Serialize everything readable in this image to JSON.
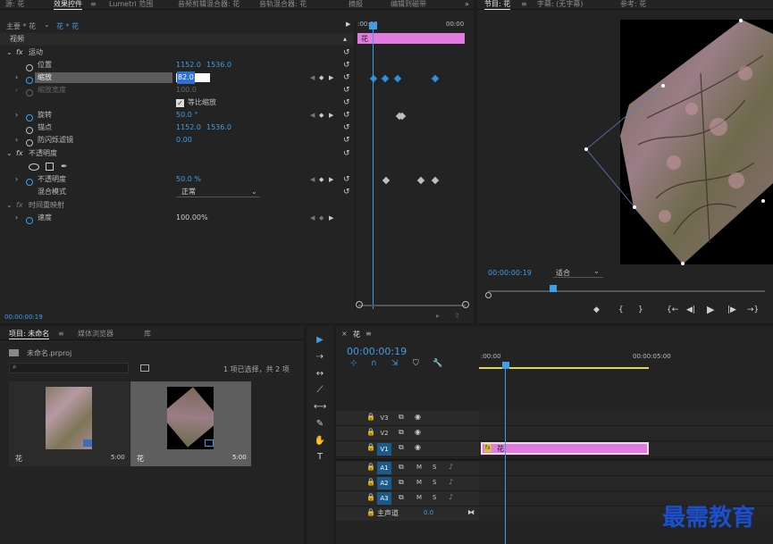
{
  "top_tabs": [
    {
      "label": "源: 花",
      "active": false
    },
    {
      "label": "效果控件",
      "active": true
    },
    {
      "label": "Lumetri 范围",
      "active": false
    },
    {
      "label": "音频剪辑混合器: 花",
      "active": false
    },
    {
      "label": "音轨混合器: 花",
      "active": false
    },
    {
      "label": "摘报",
      "active": false
    },
    {
      "label": "编辑到磁带",
      "active": false
    }
  ],
  "tab_menu_glyph": "≡",
  "overflow_glyph": "»",
  "effect_controls": {
    "master": "主要 * 花",
    "clip": "花 * 花",
    "ruler_start": ":00:00",
    "ruler_end": "00:00",
    "clip_bar_label": "花",
    "section_video": "视频",
    "motion": "运动",
    "position": {
      "label": "位置",
      "x": "1152.0",
      "y": "1536.0"
    },
    "scale": {
      "label": "缩放",
      "value": "82.0"
    },
    "scale_width": {
      "label": "缩放宽度",
      "value": "100.0"
    },
    "uniform_scale": {
      "label": "等比缩放",
      "checked": true
    },
    "rotation": {
      "label": "旋转",
      "value": "50.0 °"
    },
    "anchor": {
      "label": "锚点",
      "x": "1152.0",
      "y": "1536.0"
    },
    "antiflicker": {
      "label": "防闪烁滤镜",
      "value": "0.00"
    },
    "opacity_section": "不透明度",
    "opacity": {
      "label": "不透明度",
      "value": "50.0 %"
    },
    "blend": {
      "label": "混合模式",
      "value": "正常"
    },
    "time_remap": "时间重映射",
    "speed": {
      "label": "速度",
      "value": "100.00%"
    },
    "timecode": "00:00:00:19"
  },
  "program": {
    "tabs": [
      {
        "label": "节目: 花",
        "active": true
      },
      {
        "label": "字幕: (无字幕)",
        "active": false
      },
      {
        "label": "参考: 花",
        "active": false
      }
    ],
    "timecode": "00:00:00:19",
    "fit": "适合",
    "transport": [
      "◆",
      "{",
      "}",
      "{←",
      "◀|",
      "▶",
      "|▶",
      "→}"
    ]
  },
  "project": {
    "tabs": [
      {
        "label": "项目: 未命名",
        "active": true
      },
      {
        "label": "媒体浏览器",
        "active": false
      },
      {
        "label": "库",
        "active": false
      }
    ],
    "file": "未命名.prproj",
    "selection": "1 项已选择，共 2 项",
    "items": [
      {
        "name": "花",
        "duration": "5:00"
      },
      {
        "name": "花",
        "duration": "5:00"
      }
    ]
  },
  "tools": [
    "▶",
    "⇢",
    "↔",
    "⟋",
    "⟷",
    "✎",
    "✋",
    "T"
  ],
  "timeline": {
    "tab": "花",
    "close": "×",
    "timecode": "00:00:00:19",
    "ruler_start": ":00:00",
    "ruler_mid": "00:00:05:00",
    "video_tracks": [
      "V3",
      "V2",
      "V1"
    ],
    "audio_tracks": [
      "A1",
      "A2",
      "A3"
    ],
    "master": "主声道",
    "master_value": "0.0",
    "clip_label": "花",
    "fx_badge": "fx"
  },
  "watermark": "最需教育",
  "colors": {
    "accent": "#3f9ee8",
    "clip": "#e27be0",
    "watermark": "#1a4fd0"
  }
}
